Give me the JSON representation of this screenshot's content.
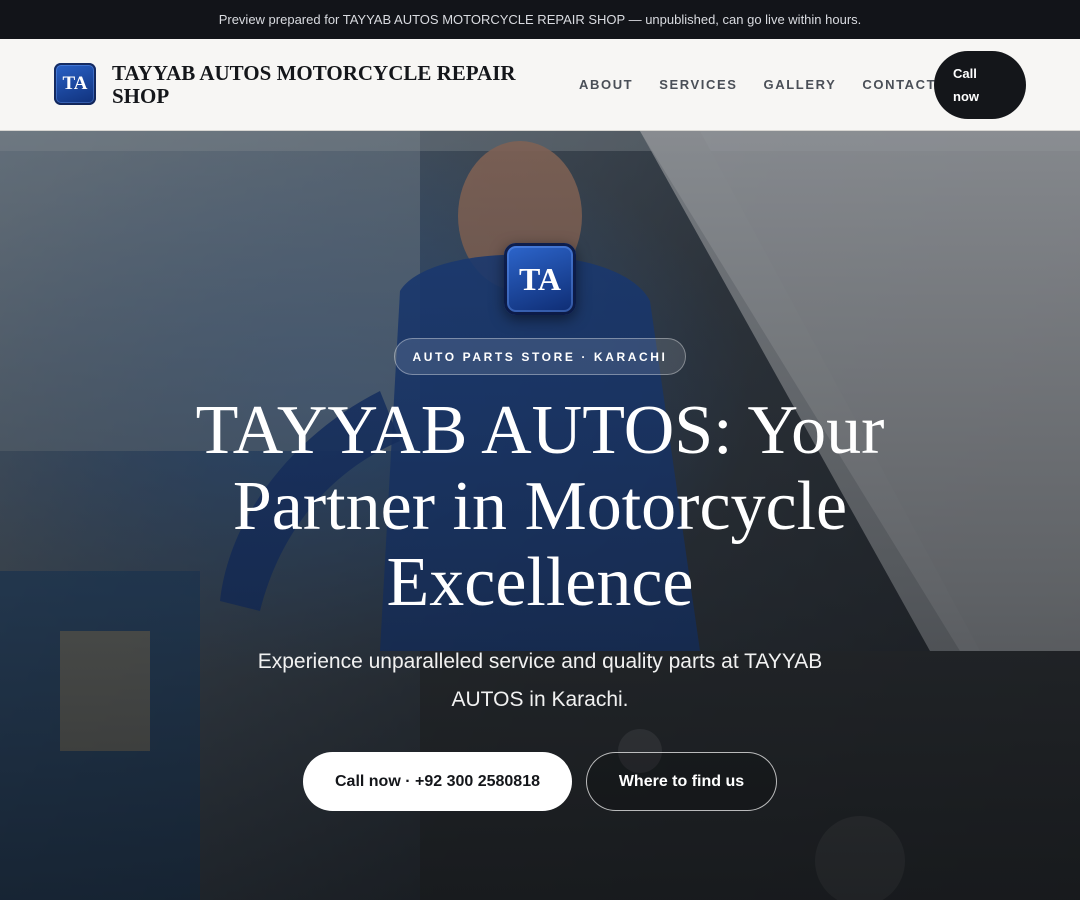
{
  "preview_bar": {
    "text": "Preview prepared for TAYYAB AUTOS MOTORCYCLE REPAIR SHOP — unpublished, can go live within hours."
  },
  "header": {
    "logo_initials": "TA",
    "brand_name": "TAYYAB AUTOS MOTORCYCLE REPAIR SHOP",
    "nav": [
      {
        "label": "ABOUT"
      },
      {
        "label": "SERVICES"
      },
      {
        "label": "GALLERY"
      },
      {
        "label": "CONTACT"
      }
    ],
    "call_label_line1": "Call",
    "call_label_line2": "now"
  },
  "hero": {
    "logo_initials": "TA",
    "eyebrow": "AUTO PARTS STORE · KARACHI",
    "title": "TAYYAB AUTOS: Your Partner in Motorcycle Excellence",
    "subtitle": "Experience unparalleled service and quality parts at TAYYAB AUTOS in Karachi.",
    "primary_cta": "Call now · +92 300 2580818",
    "secondary_cta": "Where to find us"
  },
  "colors": {
    "top_bar": "#121419",
    "header_bg": "#f7f6f4",
    "dark_button": "#14161a",
    "logo_blue": "#1e4aa8"
  }
}
